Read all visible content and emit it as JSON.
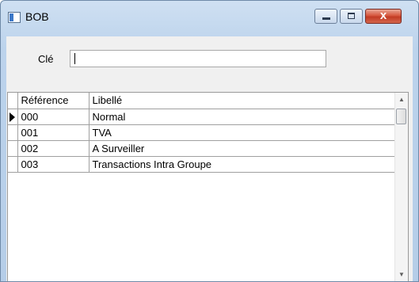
{
  "window": {
    "title": "BOB",
    "icons": {
      "app": "form-window-icon",
      "minimize": "minimize-icon",
      "maximize": "maximize-icon",
      "close": "close-icon"
    },
    "close_glyph": "x"
  },
  "search": {
    "label": "Clé",
    "value": ""
  },
  "grid": {
    "columns": [
      "Référence",
      "Libellé"
    ],
    "rows": [
      {
        "ref": "000",
        "label": "Normal"
      },
      {
        "ref": "001",
        "label": "TVA"
      },
      {
        "ref": "002",
        "label": "A Surveiller"
      },
      {
        "ref": "003",
        "label": "Transactions Intra Groupe"
      }
    ],
    "current_row_index": 0,
    "scrollbar": {
      "up_glyph": "▲",
      "down_glyph": "▼"
    }
  }
}
